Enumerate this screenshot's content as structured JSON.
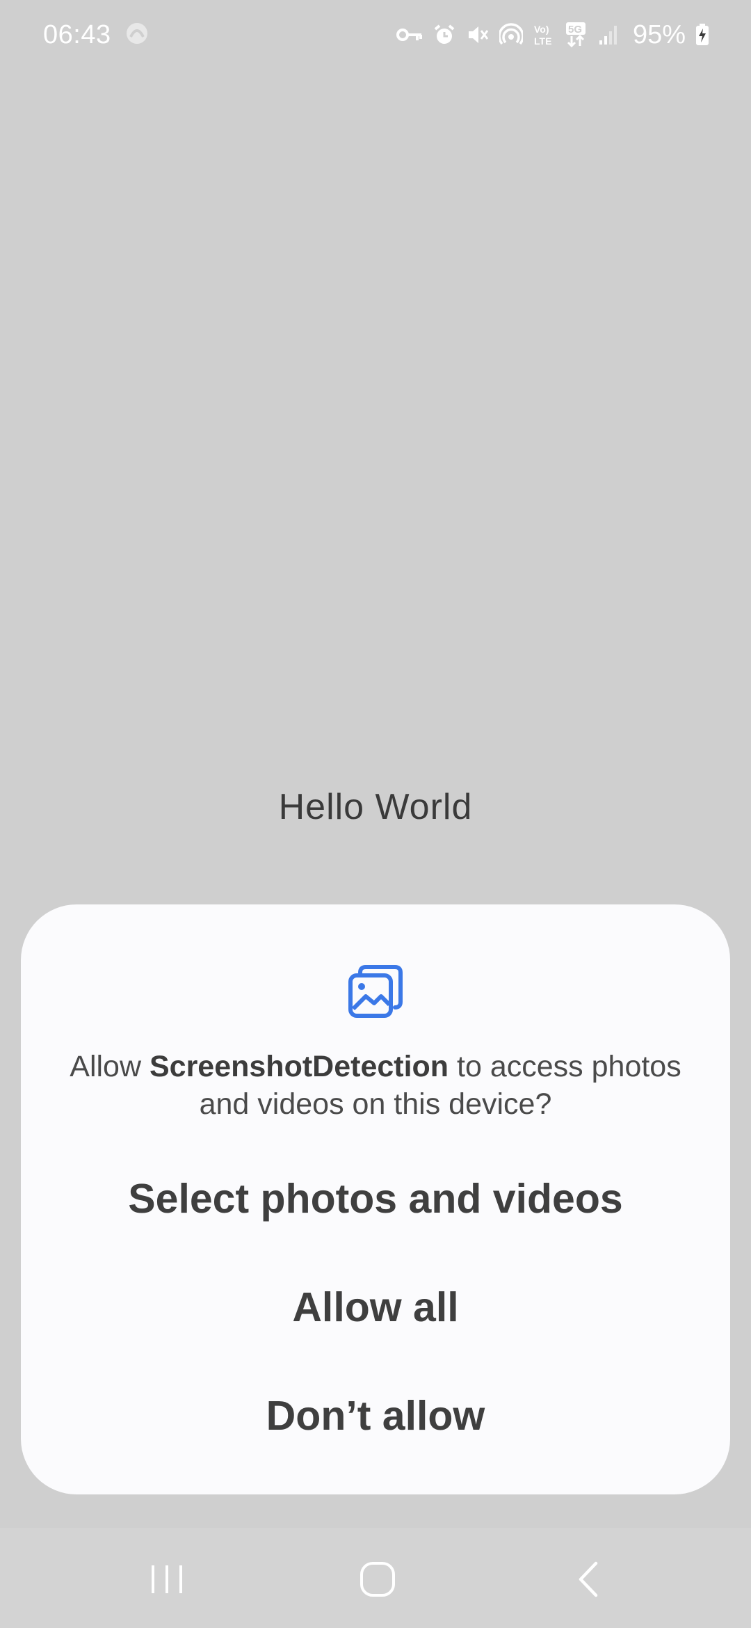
{
  "status_bar": {
    "time": "06:43",
    "battery": "95%"
  },
  "app": {
    "hello_text": "Hello World"
  },
  "dialog": {
    "message_prefix": "Allow ",
    "app_name": "ScreenshotDetection",
    "message_suffix": " to access photos and videos on this device?",
    "buttons": {
      "select": "Select photos and videos",
      "allow_all": "Allow all",
      "deny": "Don’t allow"
    },
    "accent_color": "#3b78e7"
  },
  "colors": {
    "background": "#cfcfcf",
    "dialog": "#fbfbfd",
    "nav_bar": "#d3d3d3"
  }
}
